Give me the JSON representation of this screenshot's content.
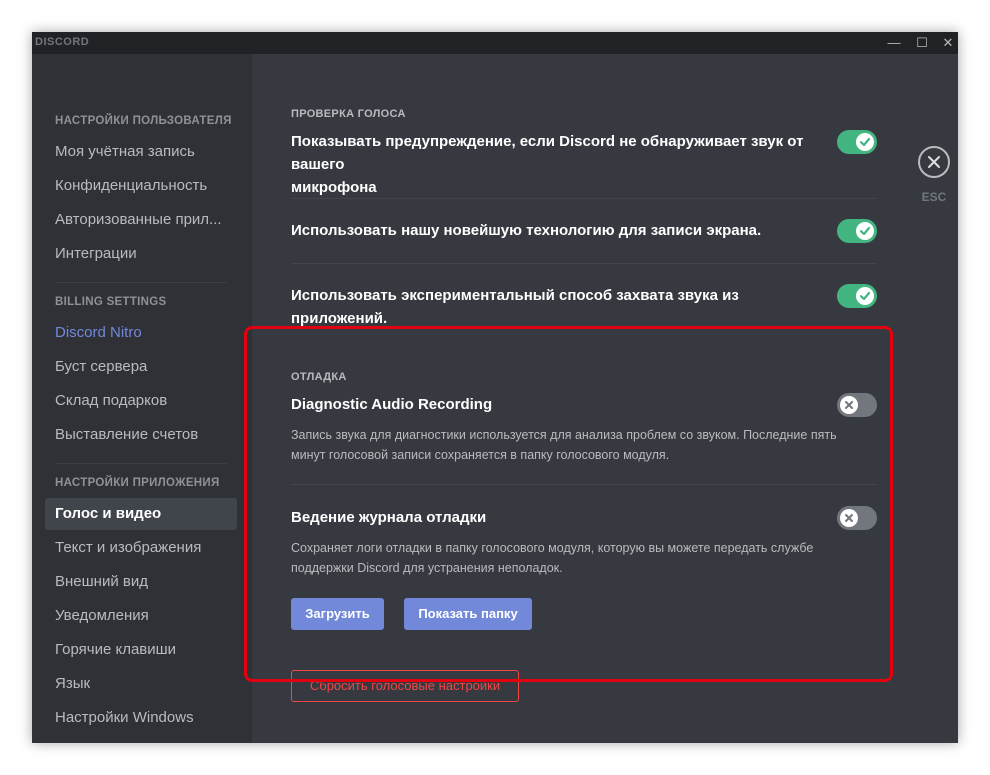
{
  "window": {
    "brand": "DISCORD",
    "controls": {
      "minimize": "—",
      "maximize": "☐",
      "close": "✕"
    }
  },
  "sidebar": {
    "user_settings_header": "Настройки пользователя",
    "user_items": [
      "Моя учётная запись",
      "Конфиденциальность",
      "Авторизованные прил...",
      "Интеграции"
    ],
    "billing_header": "Billing Settings",
    "billing_items": [
      "Discord Nitro",
      "Буст сервера",
      "Склад подарков",
      "Выставление счетов"
    ],
    "app_settings_header": "Настройки приложения",
    "app_items": [
      "Голос и видео",
      "Текст и изображения",
      "Внешний вид",
      "Уведомления",
      "Горячие клавиши",
      "Язык",
      "Настройки Windows"
    ]
  },
  "voice_check": {
    "title": "Проверка голоса",
    "warn_label_line1": "Показывать предупреждение, если Discord не обнаруживает звук от вашего",
    "warn_label_line2": "микрофона",
    "screen_tech_label": "Использовать нашу новейшую технологию для записи экрана.",
    "experimental_audio_label": "Использовать экспериментальный способ захвата звука из приложений."
  },
  "debug": {
    "title": "Отладка",
    "diag_label": "Diagnostic Audio Recording",
    "diag_desc_line1": "Запись звука для диагностики используется для анализа проблем со звуком. Последние пять",
    "diag_desc_line2": "минут голосовой записи сохраняется в папку голосового модуля.",
    "log_label": "Ведение журнала отладки",
    "log_desc_line1": "Сохраняет логи отладки в папку голосового модуля, которую вы можете передать службе",
    "log_desc_line2": "поддержки Discord для устранения неполадок.",
    "upload_button": "Загрузить",
    "show_folder_button": "Показать папку",
    "reset_button": "Сбросить голосовые настройки"
  },
  "close_panel": {
    "esc_label": "ESC"
  },
  "toggles": {
    "warn": true,
    "screen_tech": true,
    "experimental_audio": true,
    "diag_recording": false,
    "debug_logging": false
  },
  "colors": {
    "accent": "#7289da",
    "toggle_on": "#43b581",
    "toggle_off": "#72767d",
    "danger": "#f04747",
    "highlight": "#e3000f"
  }
}
